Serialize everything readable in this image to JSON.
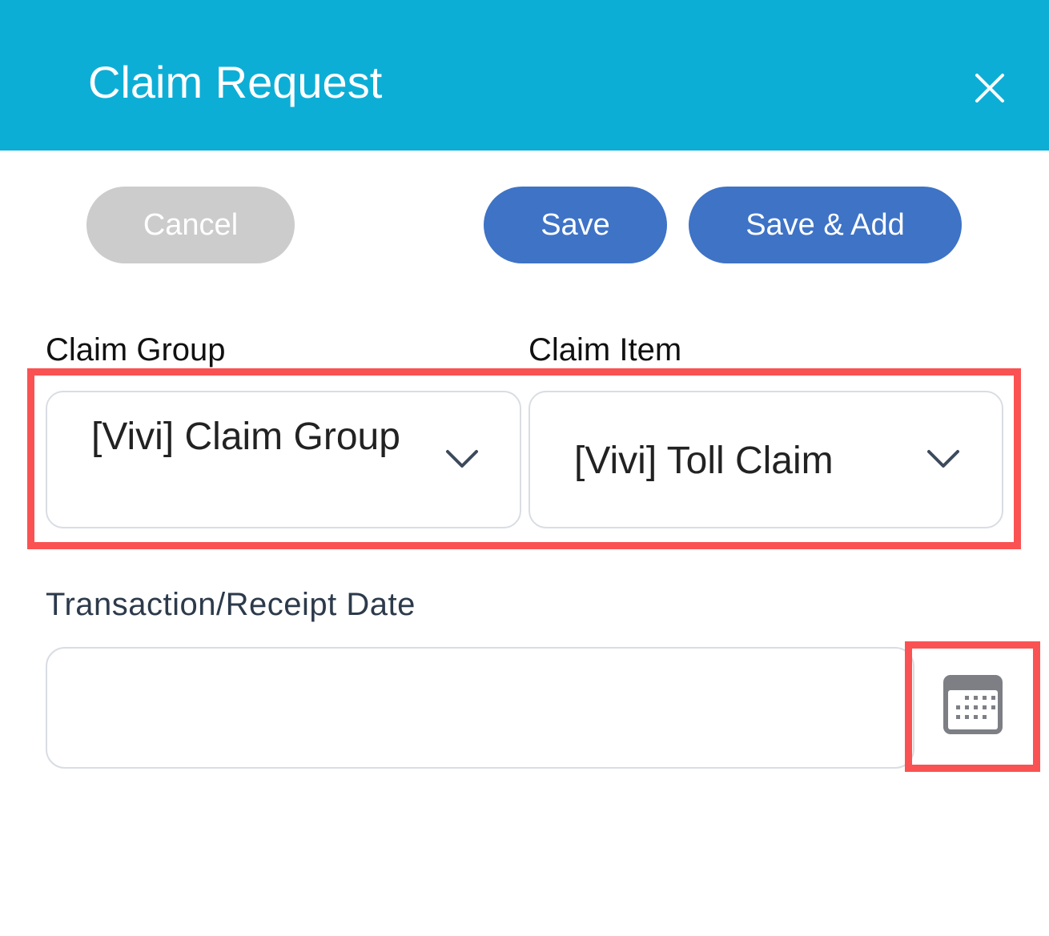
{
  "header": {
    "title": "Claim Request",
    "close_icon": "close-icon",
    "background_color": "#0daed6"
  },
  "actions": {
    "cancel_label": "Cancel",
    "save_label": "Save",
    "save_add_label": "Save & Add",
    "primary_color": "#3e73c6",
    "disabled_color": "#cccccc"
  },
  "form": {
    "claim_group": {
      "label": "Claim Group",
      "value": "[Vivi] Claim Group",
      "icon": "chevron-down-icon"
    },
    "claim_item": {
      "label": "Claim Item",
      "value": "[Vivi] Toll Claim",
      "icon": "chevron-down-icon"
    },
    "transaction_date": {
      "label": "Transaction/Receipt Date",
      "value": "",
      "icon": "calendar-icon"
    }
  },
  "highlight_color": "#fa5252"
}
